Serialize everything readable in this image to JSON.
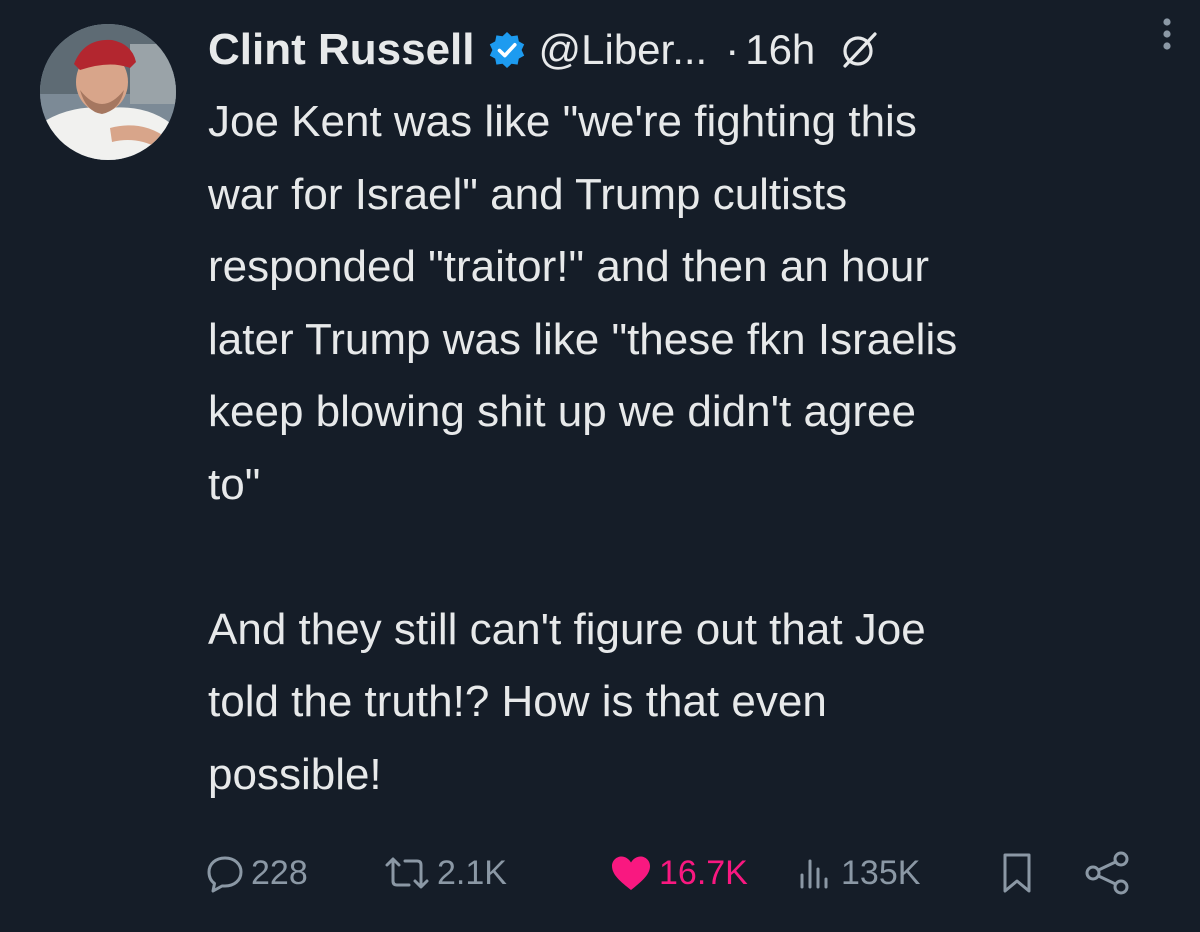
{
  "tweet": {
    "display_name": "Clint Russell",
    "handle": "@Liber...",
    "separator": "·",
    "time": "16h",
    "text_paragraphs": [
      "Joe Kent was like \"we're fighting this\nwar for Israel\" and Trump cultists\nresponded \"traitor!\" and then an hour\nlater Trump was like \"these fkn Israelis\nkeep blowing shit up we didn't agree\nto\"\n\nAnd they still can't figure out that Joe\ntold the truth!? How is that even\npossible!"
    ]
  },
  "actions": {
    "replies": "228",
    "reposts": "2.1K",
    "likes": "16.7K",
    "views": "135K"
  },
  "colors": {
    "background": "#151d28",
    "text": "#e7e9ea",
    "muted": "#8b98a5",
    "verified": "#1d9bf0",
    "like": "#f91880"
  },
  "icons": [
    "verified-badge-icon",
    "grok-icon",
    "more-icon",
    "reply-icon",
    "repost-icon",
    "like-icon",
    "views-icon",
    "bookmark-icon",
    "share-icon"
  ]
}
